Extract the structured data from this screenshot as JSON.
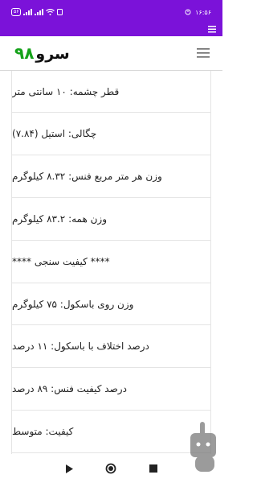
{
  "status_bar": {
    "time": "۱۶:۵۶",
    "battery_badge": "۵۶",
    "bg_color": "#7b12d9"
  },
  "app_bar": {
    "title_word": "سرو",
    "title_number": "۹۸",
    "menu_icon": "hamburger-icon"
  },
  "items": [
    "قطر چشمه: ۱۰ سانتی متر",
    "چگالی: استیل (۷.۸۴)",
    "وزن هر متر مربع فنس: ۸.۳۲ کیلوگرم",
    "وزن همه: ۸۳.۲ کیلوگرم",
    "**** کیفیت سنجی ****",
    "وزن روی باسکول: ۷۵ کیلوگرم",
    "درصد اختلاف با باسکول: ۱۱ درصد",
    "درصد کیفیت فنس: ۸۹ درصد",
    "کیفیت: متوسط"
  ],
  "nav_bar": {
    "back_icon": "triangle-back-icon",
    "home_icon": "circle-home-icon",
    "recents_icon": "square-recents-icon"
  }
}
